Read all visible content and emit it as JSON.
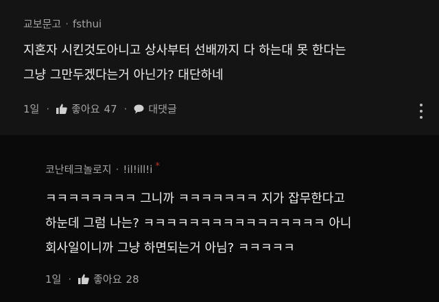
{
  "comments": [
    {
      "author": "교보문고",
      "username": "fsthui",
      "separator": "·",
      "lines": [
        "지혼자 시킨것도아니고 상사부터 선배까지 다 하는대 못 한다는",
        "그냥 그만두겠다는거 아닌가? 대단하네"
      ],
      "time": "1일",
      "like_label": "좋아요",
      "like_count": "47",
      "reply_label": "대댓글",
      "icons": {
        "like": "thumbs-up-icon",
        "reply": "speech-bubble-icon",
        "more": "more-vertical-icon"
      }
    },
    {
      "author": "코난테크놀로지",
      "username": "!il!ill!i",
      "separator": "·",
      "badge": "*",
      "badge_color": "#c0392b",
      "lines": [
        "ㅋㅋㅋㅋㅋㅋㅋㅋ 그니까 ㅋㅋㅋㅋㅋㅋㅋ  지가 잡무한다고",
        "하눈데 그럼 나는? ㅋㅋㅋㅋㅋㅋㅋㅋㅋㅋㅋㅋㅋㅋㅋㅋ 아니",
        "회사일이니까 그냥 하면되는거 아님? ㅋㅋㅋㅋㅋ"
      ],
      "time": "1일",
      "like_label": "좋아요",
      "like_count": "28",
      "icons": {
        "like": "thumbs-up-icon"
      }
    }
  ],
  "colors": {
    "background": "#141414",
    "reply_background": "#0a0a0a",
    "text": "#eeeeee",
    "meta": "#a5a5a5"
  }
}
